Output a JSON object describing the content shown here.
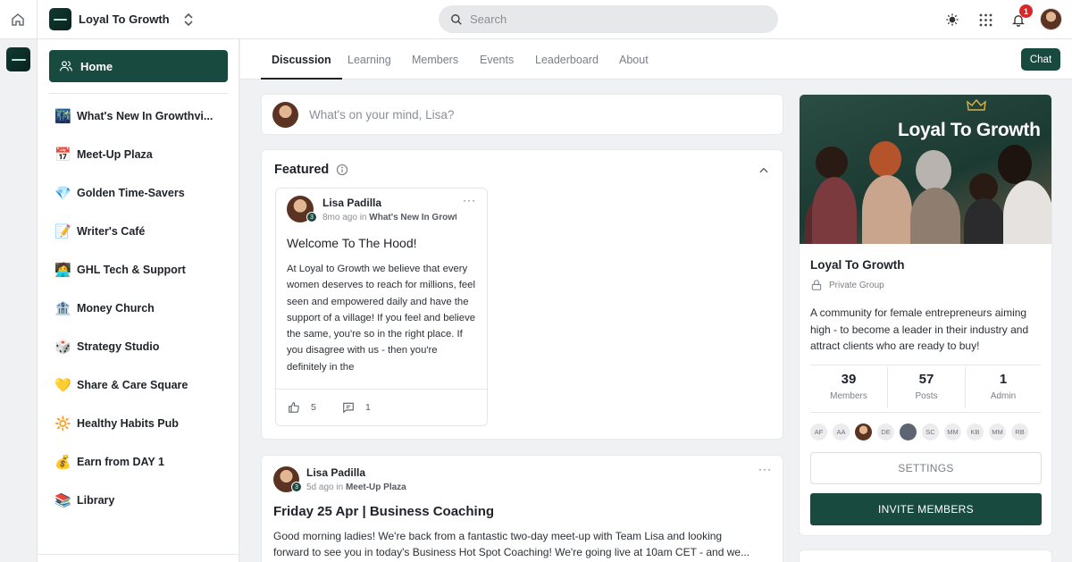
{
  "header": {
    "group_name": "Loyal To Growth",
    "search_placeholder": "Search",
    "notification_count": "1"
  },
  "sidebar": {
    "home_label": "Home",
    "items": [
      {
        "emoji": "🌃",
        "label": "What's New In Growthvi..."
      },
      {
        "emoji": "📅",
        "label": "Meet-Up Plaza"
      },
      {
        "emoji": "💎",
        "label": "Golden Time-Savers"
      },
      {
        "emoji": "📝",
        "label": "Writer's Café"
      },
      {
        "emoji": "🧑‍💻",
        "label": "GHL Tech & Support"
      },
      {
        "emoji": "🏦",
        "label": "Money Church"
      },
      {
        "emoji": "🎲",
        "label": "Strategy Studio"
      },
      {
        "emoji": "💛",
        "label": "Share & Care Square"
      },
      {
        "emoji": "🔆",
        "label": "Healthy Habits Pub"
      },
      {
        "emoji": "💰",
        "label": "Earn from DAY 1"
      },
      {
        "emoji": "📚",
        "label": "Library"
      }
    ]
  },
  "tabs": {
    "discussion": "Discussion",
    "learning": "Learning",
    "members": "Members",
    "events": "Events",
    "leaderboard": "Leaderboard",
    "about": "About",
    "chat": "Chat"
  },
  "composer": {
    "placeholder": "What's on your mind, Lisa?"
  },
  "featured": {
    "title": "Featured",
    "post": {
      "author": "Lisa Padilla",
      "level": "3",
      "time": "8mo ago in ",
      "channel": "What's New In Growthvi",
      "more": "···",
      "title": "Welcome To The Hood!",
      "body": "At Loyal to Growth we believe that every women deserves to reach for millions, feel seen and empowered daily and have the support of a village! If you feel and believe the same, you're so in the right place. If you disagree with us - then you're definitely in the",
      "likes": "5",
      "comments": "1"
    }
  },
  "post2": {
    "author": "Lisa Padilla",
    "level": "3",
    "time": "5d ago in ",
    "channel": "Meet-Up Plaza",
    "more": "···",
    "title": "Friday 25 Apr | Business Coaching",
    "body": "Good morning ladies! We're back from a fantastic two-day meet-up with Team Lisa and looking forward to see you in today's Business Hot Spot Coaching! We're going live at 10am CET - and we..."
  },
  "group_card": {
    "banner_title": "Loyal To Growth",
    "name": "Loyal To Growth",
    "privacy": "Private Group",
    "description": "A community for female entrepreneurs aiming high - to become a leader in their industry and attract clients who are ready to buy!",
    "stats": [
      {
        "value": "39",
        "label": "Members"
      },
      {
        "value": "57",
        "label": "Posts"
      },
      {
        "value": "1",
        "label": "Admin"
      }
    ],
    "member_chips": [
      "AF",
      "AA",
      "",
      "DE",
      "",
      "SC",
      "MM",
      "KB",
      "MM",
      "RB"
    ],
    "settings_label": "SETTINGS",
    "invite_label": "INVITE MEMBERS"
  },
  "colors": {
    "brand_green": "#184a40",
    "badge_red": "#d8272a"
  }
}
